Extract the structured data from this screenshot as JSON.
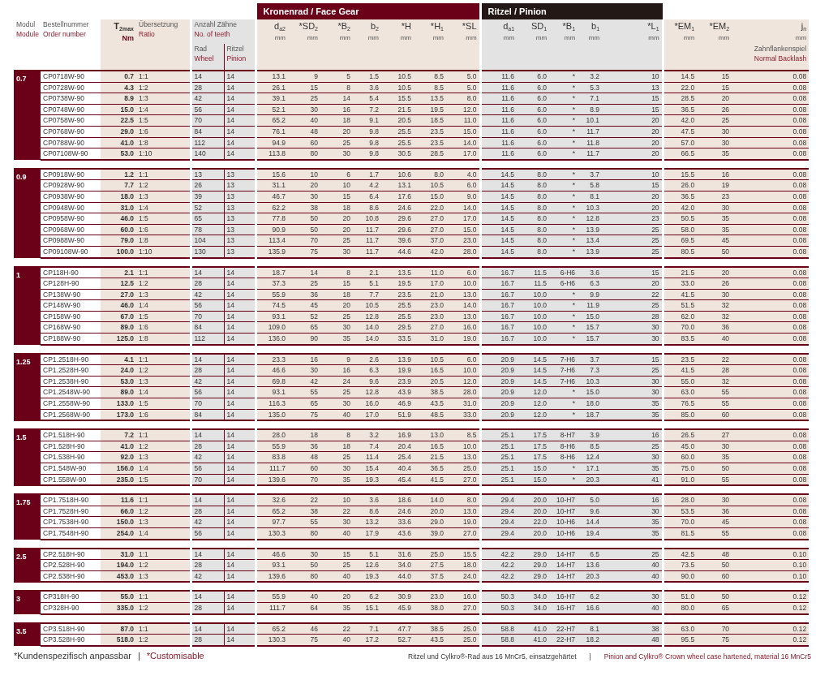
{
  "banners": [
    {
      "label": "Kronenrad / Face Gear",
      "kind": "face"
    },
    {
      "label": "Ritzel / Pinion",
      "kind": "pinion"
    }
  ],
  "teeth_header": {
    "de": "Anzahl Zähne",
    "en": "No. of teeth"
  },
  "columns": [
    {
      "kind": "module",
      "de": "Modul",
      "en": "Module"
    },
    {
      "kind": "order",
      "de": "Bestellnummer",
      "en": "Order number"
    },
    {
      "kind": "torque",
      "symbol": "T$_{2max}$",
      "unit": "Nm"
    },
    {
      "kind": "main",
      "de": "Übersetzung",
      "en": "Ratio"
    },
    {
      "kind": "teeth",
      "de": "Rad",
      "en": "Wheel"
    },
    {
      "kind": "teeth",
      "de": "Ritzel",
      "en": "Pinion"
    },
    {
      "kind": "face",
      "symbol": "d$_{a2}$",
      "unit": "mm"
    },
    {
      "kind": "face",
      "symbol": "*SD$_{2}$",
      "unit": "mm"
    },
    {
      "kind": "face",
      "symbol": "*B$_{2}$",
      "unit": "mm"
    },
    {
      "kind": "face",
      "symbol": "b$_{2}$",
      "unit": "mm"
    },
    {
      "kind": "face",
      "symbol": "*H",
      "unit": "mm"
    },
    {
      "kind": "face",
      "symbol": "*H$_{1}$",
      "unit": "mm"
    },
    {
      "kind": "face",
      "symbol": "*SL",
      "unit": "mm"
    },
    {
      "kind": "pinion",
      "symbol": "d$_{a1}$",
      "unit": "mm"
    },
    {
      "kind": "pinion",
      "symbol": "SD$_{1}$",
      "unit": "mm"
    },
    {
      "kind": "pinion",
      "symbol": "*B$_{1}$",
      "unit": "mm"
    },
    {
      "kind": "pinion",
      "symbol": "b$_{1}$",
      "unit": "mm"
    },
    {
      "kind": "pinion",
      "symbol": "*L$_{1}$",
      "unit": "mm"
    },
    {
      "kind": "extra",
      "symbol": "*EM$_{1}$",
      "unit": "mm"
    },
    {
      "kind": "extra",
      "symbol": "*EM$_{2}$",
      "unit": "mm"
    },
    {
      "kind": "extra",
      "symbol": "j$_{n}$",
      "unit": "mm",
      "de": "Zahnflankenspiel",
      "en": "Normal Backlash"
    }
  ],
  "groups": [
    {
      "module": "0.7",
      "rows": [
        [
          "CP0718W-90",
          "0.7",
          "1:1",
          "14",
          "14",
          "13.1",
          "9",
          "5",
          "1.5",
          "10.5",
          "8.5",
          "5.0",
          "11.6",
          "6.0",
          "*",
          "3.2",
          "10",
          "14.5",
          "15",
          "0.08"
        ],
        [
          "CP0728W-90",
          "4.3",
          "1:2",
          "28",
          "14",
          "26.1",
          "15",
          "8",
          "3.6",
          "10.5",
          "8.5",
          "5.0",
          "11.6",
          "6.0",
          "*",
          "5.3",
          "13",
          "22.0",
          "15",
          "0.08"
        ],
        [
          "CP0738W-90",
          "8.9",
          "1:3",
          "42",
          "14",
          "39.1",
          "25",
          "14",
          "5.4",
          "15.5",
          "13.5",
          "8.0",
          "11.6",
          "6.0",
          "*",
          "7.1",
          "15",
          "28.5",
          "20",
          "0.08"
        ],
        [
          "CP0748W-90",
          "15.0",
          "1:4",
          "56",
          "14",
          "52.1",
          "30",
          "16",
          "7.2",
          "21.5",
          "19.5",
          "12.0",
          "11.6",
          "6.0",
          "*",
          "8.9",
          "15",
          "36.5",
          "26",
          "0.08"
        ],
        [
          "CP0758W-90",
          "22.5",
          "1:5",
          "70",
          "14",
          "65.2",
          "40",
          "18",
          "9.1",
          "20.5",
          "18.5",
          "11.0",
          "11.6",
          "6.0",
          "*",
          "10.1",
          "20",
          "42.0",
          "25",
          "0.08"
        ],
        [
          "CP0768W-90",
          "29.0",
          "1:6",
          "84",
          "14",
          "76.1",
          "48",
          "20",
          "9.8",
          "25.5",
          "23.5",
          "15.0",
          "11.6",
          "6.0",
          "*",
          "11.7",
          "20",
          "47.5",
          "30",
          "0.08"
        ],
        [
          "CP0788W-90",
          "41.0",
          "1:8",
          "112",
          "14",
          "94.9",
          "60",
          "25",
          "9.8",
          "25.5",
          "23.5",
          "14.0",
          "11.6",
          "6.0",
          "*",
          "11.8",
          "20",
          "57.0",
          "30",
          "0.08"
        ],
        [
          "CP07108W-90",
          "53.0",
          "1:10",
          "140",
          "14",
          "113.8",
          "80",
          "30",
          "9.8",
          "30.5",
          "28.5",
          "17.0",
          "11.6",
          "6.0",
          "*",
          "11.7",
          "20",
          "66.5",
          "35",
          "0.08"
        ]
      ]
    },
    {
      "module": "0.9",
      "rows": [
        [
          "CP0918W-90",
          "1.2",
          "1:1",
          "13",
          "13",
          "15.6",
          "10",
          "6",
          "1.7",
          "10.6",
          "8.0",
          "4.0",
          "14.5",
          "8.0",
          "*",
          "3.7",
          "10",
          "15.5",
          "16",
          "0.08"
        ],
        [
          "CP0928W-90",
          "7.7",
          "1:2",
          "26",
          "13",
          "31.1",
          "20",
          "10",
          "4.2",
          "13.1",
          "10.5",
          "6.0",
          "14.5",
          "8.0",
          "*",
          "5.8",
          "15",
          "26.0",
          "19",
          "0.08"
        ],
        [
          "CP0938W-90",
          "18.0",
          "1:3",
          "39",
          "13",
          "46.7",
          "30",
          "15",
          "6.4",
          "17.6",
          "15.0",
          "9.0",
          "14.5",
          "8.0",
          "*",
          "8.1",
          "20",
          "36.5",
          "23",
          "0.08"
        ],
        [
          "CP0948W-90",
          "31.0",
          "1:4",
          "52",
          "13",
          "62.2",
          "38",
          "18",
          "8.6",
          "24.6",
          "22.0",
          "14.0",
          "14.5",
          "8.0",
          "*",
          "10.3",
          "20",
          "42.0",
          "30",
          "0.08"
        ],
        [
          "CP0958W-90",
          "46.0",
          "1:5",
          "65",
          "13",
          "77.8",
          "50",
          "20",
          "10.8",
          "29.6",
          "27.0",
          "17.0",
          "14.5",
          "8.0",
          "*",
          "12.8",
          "23",
          "50.5",
          "35",
          "0.08"
        ],
        [
          "CP0968W-90",
          "60.0",
          "1:6",
          "78",
          "13",
          "90.9",
          "50",
          "20",
          "11.7",
          "29.6",
          "27.0",
          "15.0",
          "14.5",
          "8.0",
          "*",
          "13.9",
          "25",
          "58.0",
          "35",
          "0.08"
        ],
        [
          "CP0988W-90",
          "79.0",
          "1:8",
          "104",
          "13",
          "113.4",
          "70",
          "25",
          "11.7",
          "39.6",
          "37.0",
          "23.0",
          "14.5",
          "8.0",
          "*",
          "13.4",
          "25",
          "69.5",
          "45",
          "0.08"
        ],
        [
          "CP09108W-90",
          "100.0",
          "1:10",
          "130",
          "13",
          "135.9",
          "75",
          "30",
          "11.7",
          "44.6",
          "42.0",
          "28.0",
          "14.5",
          "8.0",
          "*",
          "13.9",
          "25",
          "80.5",
          "50",
          "0.08"
        ]
      ]
    },
    {
      "module": "1",
      "rows": [
        [
          "CP118H-90",
          "2.1",
          "1:1",
          "14",
          "14",
          "18.7",
          "14",
          "8",
          "2.1",
          "13.5",
          "11.0",
          "6.0",
          "16.7",
          "11.5",
          "6-H6",
          "3.6",
          "15",
          "21.5",
          "20",
          "0.08"
        ],
        [
          "CP128H-90",
          "12.5",
          "1:2",
          "28",
          "14",
          "37.3",
          "25",
          "15",
          "5.1",
          "19.5",
          "17.0",
          "10.0",
          "16.7",
          "11.5",
          "6-H6",
          "6.3",
          "20",
          "33.0",
          "26",
          "0.08"
        ],
        [
          "CP138W-90",
          "27.0",
          "1:3",
          "42",
          "14",
          "55.9",
          "36",
          "18",
          "7.7",
          "23.5",
          "21.0",
          "13.0",
          "16.7",
          "10.0",
          "*",
          "9.9",
          "22",
          "41.5",
          "30",
          "0.08"
        ],
        [
          "CP148W-90",
          "46.0",
          "1:4",
          "56",
          "14",
          "74.5",
          "45",
          "20",
          "10.5",
          "25.5",
          "23.0",
          "14.0",
          "16.7",
          "10.0",
          "*",
          "11.9",
          "25",
          "51.5",
          "32",
          "0.08"
        ],
        [
          "CP158W-90",
          "67.0",
          "1:5",
          "70",
          "14",
          "93.1",
          "52",
          "25",
          "12.8",
          "25.5",
          "23.0",
          "13.0",
          "16.7",
          "10.0",
          "*",
          "15.0",
          "28",
          "62.0",
          "32",
          "0.08"
        ],
        [
          "CP168W-90",
          "89.0",
          "1:6",
          "84",
          "14",
          "109.0",
          "65",
          "30",
          "14.0",
          "29.5",
          "27.0",
          "16.0",
          "16.7",
          "10.0",
          "*",
          "15.7",
          "30",
          "70.0",
          "36",
          "0.08"
        ],
        [
          "CP188W-90",
          "125.0",
          "1:8",
          "112",
          "14",
          "136.0",
          "90",
          "35",
          "14.0",
          "33.5",
          "31.0",
          "19.0",
          "16.7",
          "10.0",
          "*",
          "15.7",
          "30",
          "83.5",
          "40",
          "0.08"
        ]
      ]
    },
    {
      "module": "1.25",
      "rows": [
        [
          "CP1.2518H-90",
          "4.1",
          "1:1",
          "14",
          "14",
          "23.3",
          "16",
          "9",
          "2.6",
          "13.9",
          "10.5",
          "6.0",
          "20.9",
          "14.5",
          "7-H6",
          "3.7",
          "15",
          "23.5",
          "22",
          "0.08"
        ],
        [
          "CP1.2528H-90",
          "24.0",
          "1:2",
          "28",
          "14",
          "46.6",
          "30",
          "16",
          "6.3",
          "19.9",
          "16.5",
          "10.0",
          "20.9",
          "14.5",
          "7-H6",
          "7.3",
          "25",
          "41.5",
          "28",
          "0.08"
        ],
        [
          "CP1.2538H-90",
          "53.0",
          "1:3",
          "42",
          "14",
          "69.8",
          "42",
          "24",
          "9.6",
          "23.9",
          "20.5",
          "12.0",
          "20.9",
          "14.5",
          "7-H6",
          "10.3",
          "30",
          "55.0",
          "32",
          "0.08"
        ],
        [
          "CP1.2548W-90",
          "89.0",
          "1:4",
          "56",
          "14",
          "93.1",
          "55",
          "25",
          "12.8",
          "43.9",
          "38.5",
          "28.0",
          "20.9",
          "12.0",
          "*",
          "15.0",
          "30",
          "63.0",
          "55",
          "0.08"
        ],
        [
          "CP1.2558W-90",
          "133.0",
          "1:5",
          "70",
          "14",
          "116.3",
          "65",
          "30",
          "16.0",
          "46.9",
          "43.5",
          "31.0",
          "20.9",
          "12.0",
          "*",
          "18.0",
          "35",
          "76.5",
          "55",
          "0.08"
        ],
        [
          "CP1.2568W-90",
          "173.0",
          "1:6",
          "84",
          "14",
          "135.0",
          "75",
          "40",
          "17.0",
          "51.9",
          "48.5",
          "33.0",
          "20.9",
          "12.0",
          "*",
          "18.7",
          "35",
          "85.0",
          "60",
          "0.08"
        ]
      ]
    },
    {
      "module": "1.5",
      "rows": [
        [
          "CP1.518H-90",
          "7.2",
          "1:1",
          "14",
          "14",
          "28.0",
          "18",
          "8",
          "3.2",
          "16.9",
          "13.0",
          "8.5",
          "25.1",
          "17.5",
          "8-H7",
          "3.9",
          "16",
          "26.5",
          "27",
          "0.08"
        ],
        [
          "CP1.528H-90",
          "41.0",
          "1:2",
          "28",
          "14",
          "55.9",
          "36",
          "18",
          "7.4",
          "20.4",
          "16.5",
          "10.0",
          "25.1",
          "17.5",
          "8-H6",
          "8.5",
          "25",
          "45.0",
          "30",
          "0.08"
        ],
        [
          "CP1.538H-90",
          "92.0",
          "1:3",
          "42",
          "14",
          "83.8",
          "48",
          "25",
          "11.4",
          "25.4",
          "21.5",
          "13.0",
          "25.1",
          "17.5",
          "8-H6",
          "12.4",
          "30",
          "60.0",
          "35",
          "0.08"
        ],
        [
          "CP1.548W-90",
          "156.0",
          "1:4",
          "56",
          "14",
          "111.7",
          "60",
          "30",
          "15.4",
          "40.4",
          "36.5",
          "25.0",
          "25.1",
          "15.0",
          "*",
          "17.1",
          "35",
          "75.0",
          "50",
          "0.08"
        ],
        [
          "CP1.558W-90",
          "235.0",
          "1:5",
          "70",
          "14",
          "139.6",
          "70",
          "35",
          "19.3",
          "45.4",
          "41.5",
          "27.0",
          "25.1",
          "15.0",
          "*",
          "20.3",
          "41",
          "91.0",
          "55",
          "0.08"
        ]
      ]
    },
    {
      "module": "1.75",
      "rows": [
        [
          "CP1.7518H-90",
          "11.6",
          "1:1",
          "14",
          "14",
          "32.6",
          "22",
          "10",
          "3.6",
          "18.6",
          "14.0",
          "8.0",
          "29.4",
          "20.0",
          "10-H7",
          "5.0",
          "16",
          "28.0",
          "30",
          "0.08"
        ],
        [
          "CP1.7528H-90",
          "66.0",
          "1:2",
          "28",
          "14",
          "65.2",
          "38",
          "22",
          "8.6",
          "24.6",
          "20.0",
          "13.0",
          "29.4",
          "20.0",
          "10-H7",
          "9.6",
          "30",
          "53.5",
          "36",
          "0.08"
        ],
        [
          "CP1.7538H-90",
          "150.0",
          "1:3",
          "42",
          "14",
          "97.7",
          "55",
          "30",
          "13.2",
          "33.6",
          "29.0",
          "19.0",
          "29.4",
          "22.0",
          "10-H6",
          "14.4",
          "35",
          "70.0",
          "45",
          "0.08"
        ],
        [
          "CP1.7548H-90",
          "254.0",
          "1:4",
          "56",
          "14",
          "130.3",
          "80",
          "40",
          "17.9",
          "43.6",
          "39.0",
          "27.0",
          "29.4",
          "20.0",
          "10-H6",
          "19.4",
          "35",
          "81.5",
          "55",
          "0.08"
        ]
      ]
    },
    {
      "module": "2.5",
      "rows": [
        [
          "CP2.518H-90",
          "31.0",
          "1:1",
          "14",
          "14",
          "46.6",
          "30",
          "15",
          "5.1",
          "31.6",
          "25.0",
          "15.5",
          "42.2",
          "29.0",
          "14-H7",
          "6.5",
          "25",
          "42.5",
          "48",
          "0.10"
        ],
        [
          "CP2.528H-90",
          "194.0",
          "1:2",
          "28",
          "14",
          "93.1",
          "50",
          "25",
          "12.6",
          "34.0",
          "27.5",
          "18.0",
          "42.2",
          "29.0",
          "14-H7",
          "13.6",
          "40",
          "73.5",
          "50",
          "0.10"
        ],
        [
          "CP2.538H-90",
          "453.0",
          "1:3",
          "42",
          "14",
          "139.6",
          "80",
          "40",
          "19.3",
          "44.0",
          "37.5",
          "24.0",
          "42.2",
          "29.0",
          "14-H7",
          "20.3",
          "40",
          "90.0",
          "60",
          "0.10"
        ]
      ]
    },
    {
      "module": "3",
      "rows": [
        [
          "CP318H-90",
          "55.0",
          "1:1",
          "14",
          "14",
          "55.9",
          "40",
          "20",
          "6.2",
          "30.9",
          "23.0",
          "16.0",
          "50.3",
          "34.0",
          "16-H7",
          "6.2",
          "30",
          "51.0",
          "50",
          "0.12"
        ],
        [
          "CP328H-90",
          "335.0",
          "1:2",
          "28",
          "14",
          "111.7",
          "64",
          "35",
          "15.1",
          "45.9",
          "38.0",
          "27.0",
          "50.3",
          "34.0",
          "16-H7",
          "16.6",
          "40",
          "80.0",
          "65",
          "0.12"
        ]
      ]
    },
    {
      "module": "3.5",
      "rows": [
        [
          "CP3.518H-90",
          "87.0",
          "1:1",
          "14",
          "14",
          "65.2",
          "46",
          "22",
          "7.1",
          "47.7",
          "38.5",
          "25.0",
          "58.8",
          "41.0",
          "22-H7",
          "8.1",
          "38",
          "63.0",
          "70",
          "0.12"
        ],
        [
          "CP3.528H-90",
          "518.0",
          "1:2",
          "28",
          "14",
          "130.3",
          "75",
          "40",
          "17.2",
          "52.7",
          "43.5",
          "25.0",
          "58.8",
          "41.0",
          "22-H7",
          "18.2",
          "48",
          "95.5",
          "75",
          "0.12"
        ]
      ]
    }
  ],
  "footer": {
    "left": [
      {
        "text": "*Kundenspezifisch anpassbar",
        "kind": "de"
      },
      {
        "text": "|",
        "kind": "sep"
      },
      {
        "text": "*Customisable",
        "kind": "en"
      }
    ],
    "right": [
      {
        "text": "Ritzel und Cylkro®-Rad aus 16 MnCr5, einsatzgehärtet",
        "kind": "de"
      },
      {
        "text": "|",
        "kind": "sep"
      },
      {
        "text": "Pinion and Cylkro® Crown wheel case hartened, material 16 MnCr5",
        "kind": "en"
      }
    ]
  }
}
